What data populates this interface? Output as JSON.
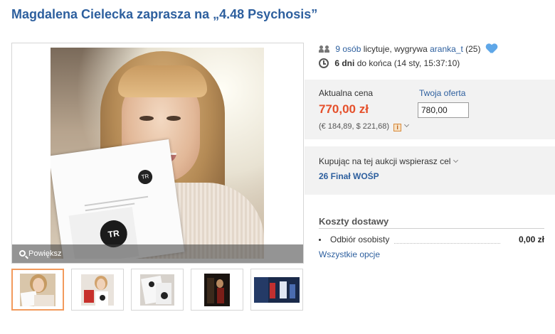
{
  "title": "Magdalena Cielecka zaprasza na „4.48 Psychosis”",
  "gallery": {
    "zoom_label": "Powiększ",
    "photo_badge": "TR"
  },
  "auction": {
    "bidders_link": "9 osób",
    "bidders_text": "licytuje, wygrywa",
    "winner_link": "aranka_t",
    "winner_score": "(25)",
    "time_left": "6 dni",
    "time_text": "do końca (14 sty, 15:37:10)"
  },
  "price": {
    "current_label": "Aktualna cena",
    "current_value": "770,00 zł",
    "converted": "(€ 184,89, $ 221,68)",
    "offer_label": "Twoja oferta",
    "offer_value": "780,00"
  },
  "cause": {
    "label": "Kupując na tej aukcji wspierasz cel",
    "link": "26 Finał WOŚP"
  },
  "shipping": {
    "title": "Koszty dostawy",
    "option_name": "Odbiór osobisty",
    "option_cost": "0,00 zł",
    "all_options": "Wszystkie opcje"
  },
  "colors": {
    "link": "#2d5f9e",
    "price": "#e5502b",
    "active_thumb": "#f29a5c",
    "heart": "#5fa7e8"
  }
}
